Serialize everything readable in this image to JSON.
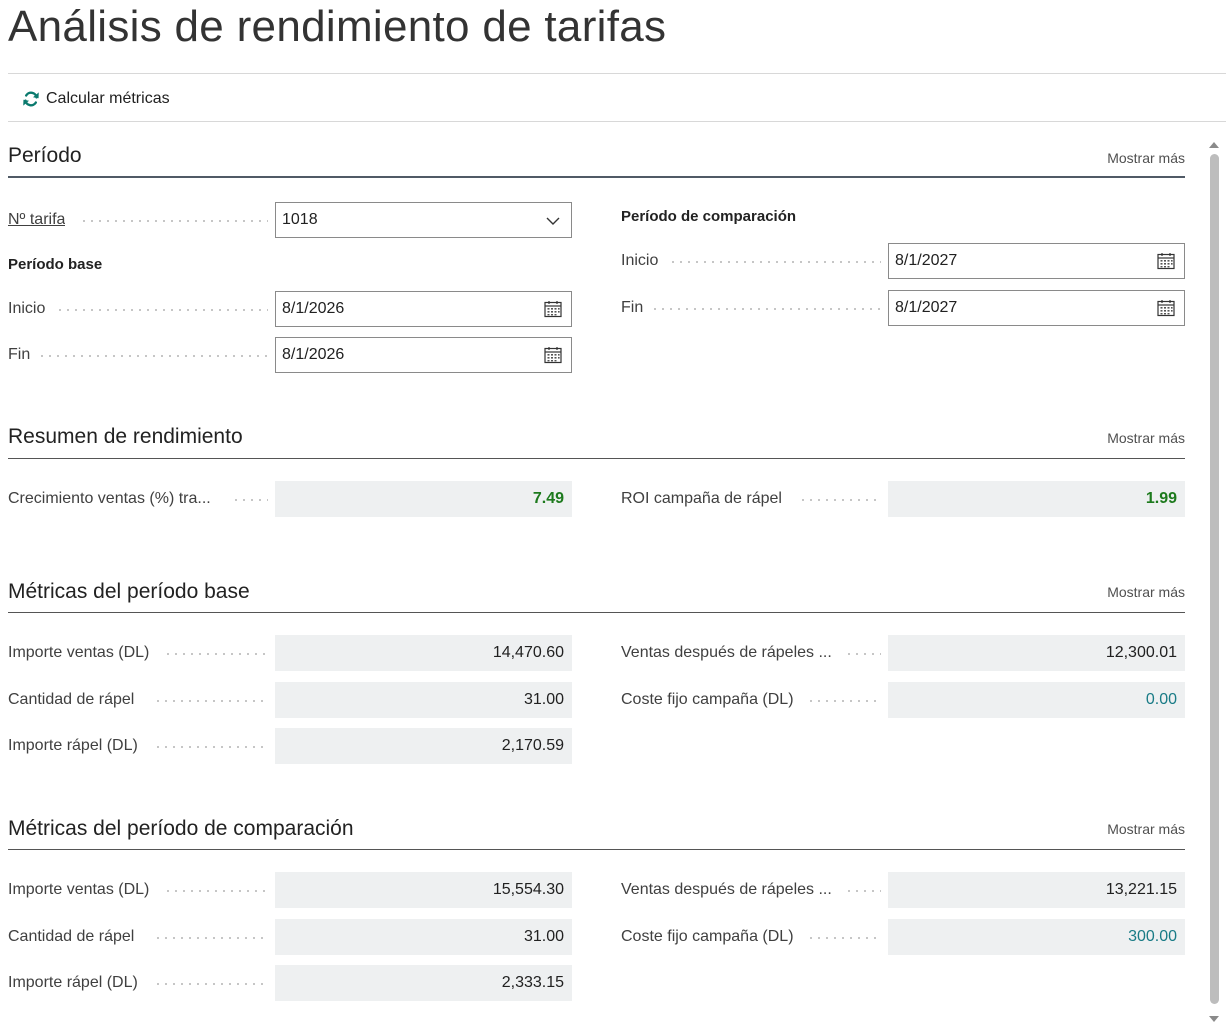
{
  "title": "Análisis de rendimiento de tarifas",
  "actions": {
    "calculate": "Calcular métricas"
  },
  "show_more": "Mostrar más",
  "period": {
    "title": "Período",
    "price_list_label": "Nº tarifa",
    "price_list_value": "1018",
    "base_heading": "Período base",
    "comparison_heading": "Período de comparación",
    "start_label": "Inicio",
    "end_label": "Fin",
    "base_start": "8/1/2026",
    "base_end": "8/1/2026",
    "comp_start": "8/1/2027",
    "comp_end": "8/1/2027"
  },
  "summary": {
    "title": "Resumen de rendimiento",
    "growth_label": "Crecimiento ventas (%) tra...",
    "growth_value": "7.49",
    "roi_label": "ROI campaña de rápel",
    "roi_value": "1.99"
  },
  "base_metrics": {
    "title": "Métricas del período base",
    "sales_amount_label": "Importe ventas (DL)",
    "sales_amount": "14,470.60",
    "rebate_qty_label": "Cantidad de rápel",
    "rebate_qty": "31.00",
    "rebate_amount_label": "Importe rápel (DL)",
    "rebate_amount": "2,170.59",
    "net_sales_label": "Ventas después de rápeles ...",
    "net_sales": "12,300.01",
    "fixed_cost_label": "Coste fijo campaña (DL)",
    "fixed_cost": "0.00"
  },
  "comp_metrics": {
    "title": "Métricas del período de comparación",
    "sales_amount_label": "Importe ventas (DL)",
    "sales_amount": "15,554.30",
    "rebate_qty_label": "Cantidad de rápel",
    "rebate_qty": "31.00",
    "rebate_amount_label": "Importe rápel (DL)",
    "rebate_amount": "2,333.15",
    "net_sales_label": "Ventas después de rápeles ...",
    "net_sales": "13,221.15",
    "fixed_cost_label": "Coste fijo campaña (DL)",
    "fixed_cost": "300.00"
  },
  "colors": {
    "positive": "#1d7a1d",
    "link_value": "#197b86",
    "refresh_icon": "#0b7a6e"
  },
  "icons": [
    "refresh-icon",
    "chevron-down-icon",
    "calendar-icon",
    "scroll-up-icon",
    "scroll-down-icon"
  ]
}
